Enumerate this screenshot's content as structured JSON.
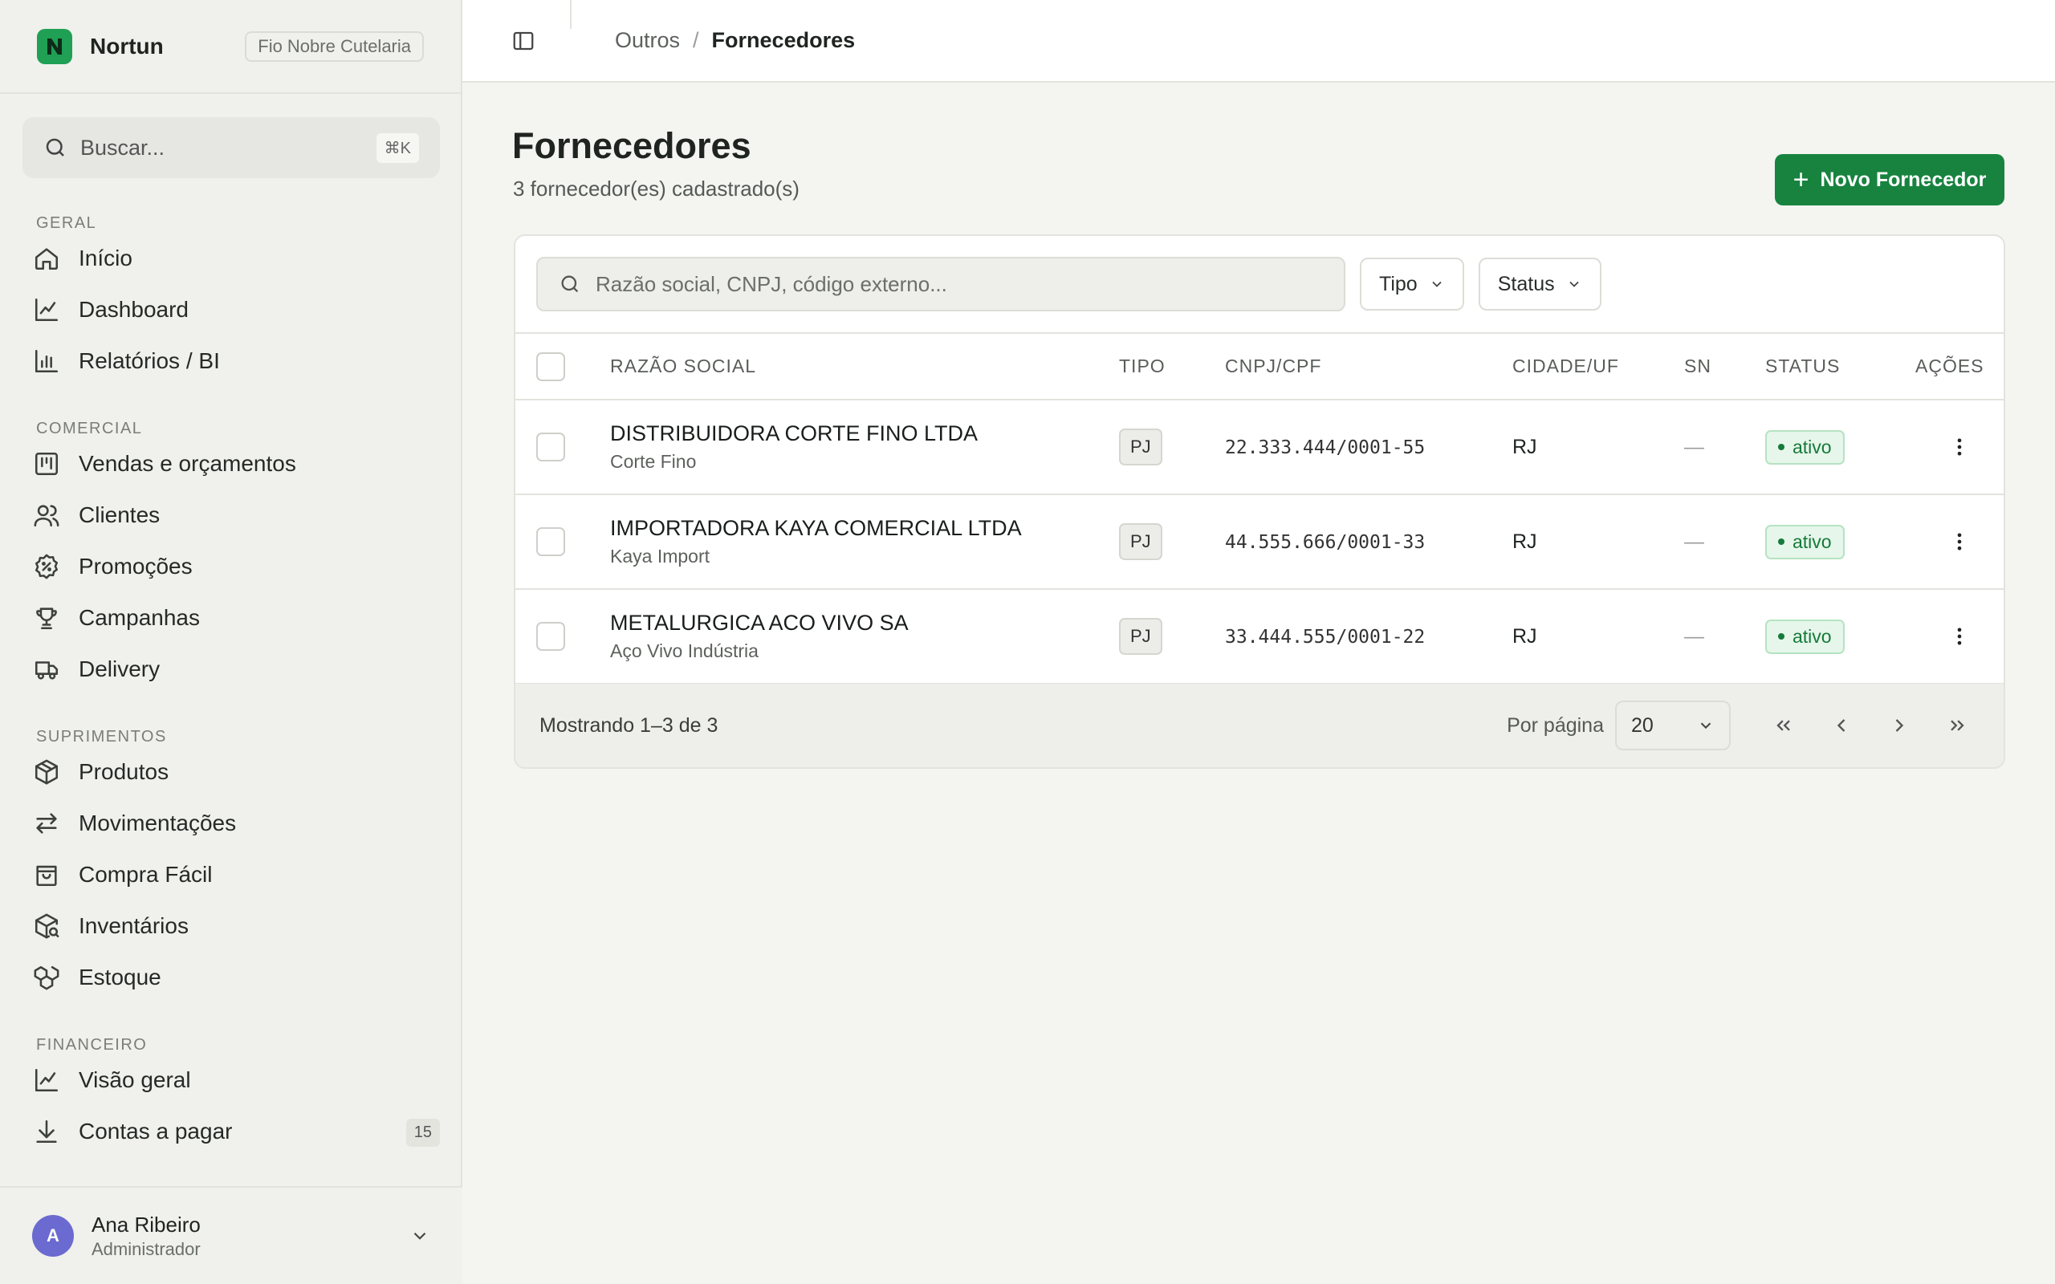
{
  "app": {
    "name": "Nortun",
    "org": "Fio Nobre Cutelaria"
  },
  "search": {
    "placeholder": "Buscar...",
    "shortcut": "⌘K"
  },
  "nav": {
    "sections": [
      {
        "title": "GERAL",
        "items": [
          {
            "label": "Início",
            "icon": "home-icon"
          },
          {
            "label": "Dashboard",
            "icon": "chart-line-icon"
          },
          {
            "label": "Relatórios / BI",
            "icon": "bar-chart-icon"
          }
        ]
      },
      {
        "title": "COMERCIAL",
        "items": [
          {
            "label": "Vendas e orçamentos",
            "icon": "kanban-icon"
          },
          {
            "label": "Clientes",
            "icon": "users-icon"
          },
          {
            "label": "Promoções",
            "icon": "percent-badge-icon"
          },
          {
            "label": "Campanhas",
            "icon": "trophy-icon"
          },
          {
            "label": "Delivery",
            "icon": "truck-icon"
          }
        ]
      },
      {
        "title": "SUPRIMENTOS",
        "items": [
          {
            "label": "Produtos",
            "icon": "package-icon"
          },
          {
            "label": "Movimentações",
            "icon": "arrows-exchange-icon"
          },
          {
            "label": "Compra Fácil",
            "icon": "shopping-bag-icon"
          },
          {
            "label": "Inventários",
            "icon": "package-search-icon"
          },
          {
            "label": "Estoque",
            "icon": "boxes-icon"
          }
        ]
      },
      {
        "title": "FINANCEIRO",
        "items": [
          {
            "label": "Visão geral",
            "icon": "chart-line-icon"
          },
          {
            "label": "Contas a pagar",
            "icon": "download-icon",
            "badge": "15"
          }
        ]
      }
    ]
  },
  "user": {
    "name": "Ana Ribeiro",
    "role": "Administrador",
    "initial": "A"
  },
  "breadcrumb": {
    "parent": "Outros",
    "separator": "/",
    "current": "Fornecedores"
  },
  "page": {
    "title": "Fornecedores",
    "subtitle": "3 fornecedor(es) cadastrado(s)",
    "new_button": "Novo Fornecedor"
  },
  "filters": {
    "search_placeholder": "Razão social, CNPJ, código externo...",
    "tipo": "Tipo",
    "status": "Status"
  },
  "table": {
    "headers": [
      "RAZÃO SOCIAL",
      "TIPO",
      "CNPJ/CPF",
      "CIDADE/UF",
      "SN",
      "STATUS",
      "AÇÕES"
    ],
    "rows": [
      {
        "name": "DISTRIBUIDORA CORTE FINO LTDA",
        "fantasy": "Corte Fino",
        "tipo": "PJ",
        "doc": "22.333.444/0001-55",
        "uf": "RJ",
        "sn": "—",
        "status": "ativo"
      },
      {
        "name": "IMPORTADORA KAYA COMERCIAL LTDA",
        "fantasy": "Kaya Import",
        "tipo": "PJ",
        "doc": "44.555.666/0001-33",
        "uf": "RJ",
        "sn": "—",
        "status": "ativo"
      },
      {
        "name": "METALURGICA ACO VIVO SA",
        "fantasy": "Aço Vivo Indústria",
        "tipo": "PJ",
        "doc": "33.444.555/0001-22",
        "uf": "RJ",
        "sn": "—",
        "status": "ativo"
      }
    ]
  },
  "footer": {
    "info": "Mostrando 1–3 de 3",
    "per_page_label": "Por página",
    "per_page_value": "20"
  },
  "colors": {
    "accent": "#17833f",
    "status_active": "#167a3a"
  }
}
